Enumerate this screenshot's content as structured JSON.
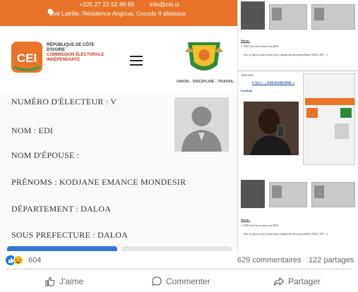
{
  "post_image": {
    "left": {
      "top_bar": {
        "phone": "+225 27 22 52 89 89",
        "email": "info@cei.ci",
        "address": "Bvd Latrille, Résidence Angoua, Cocody II plateaux"
      },
      "header": {
        "logo_text": "CEI",
        "org_line1": "RÉPUBLIQUE DE CÔTE D'IVOIRE",
        "org_line2": "COMMISSION ÉLECTORALE INDÉPENDANTE",
        "motto": "UNION - DISCIPLINE - TRAVAIL"
      },
      "fields": [
        "NUMÉRO D'ÉLECTEUR : V",
        "NOM : EDI",
        "NOM D'ÉPOUSE :",
        "PRÉNOMS : KODJANE EMANCE MONDESIR",
        "DÉPARTEMENT : DALOA",
        "SOUS PREFECTURE : DALOA"
      ]
    },
    "right": {
      "heading_a": "Saison :",
      "line_a1": "1. EDI s'est fait recenser en 2016.",
      "line_a2": "Soit ce qui fut fait recensé pour chaque élection précédente (2016, 2017...)",
      "date": "18/03/2025",
      "case_title": "CAS 1 : « EDI KODJANE »",
      "facebook_line": "Facebook",
      "heading_b": "Saison :",
      "line_b1": "1. EDI s'est fait recenser en 2016.",
      "line_b2": "Soit ce qui fut fait recensé pour chaque élection précédente (2016, 2017...)"
    }
  },
  "reactions": {
    "count": "604",
    "comments": "629 commentaires",
    "shares": "122 partages"
  },
  "actions": {
    "like": "J'aime",
    "comment": "Commenter",
    "share": "Partager"
  }
}
